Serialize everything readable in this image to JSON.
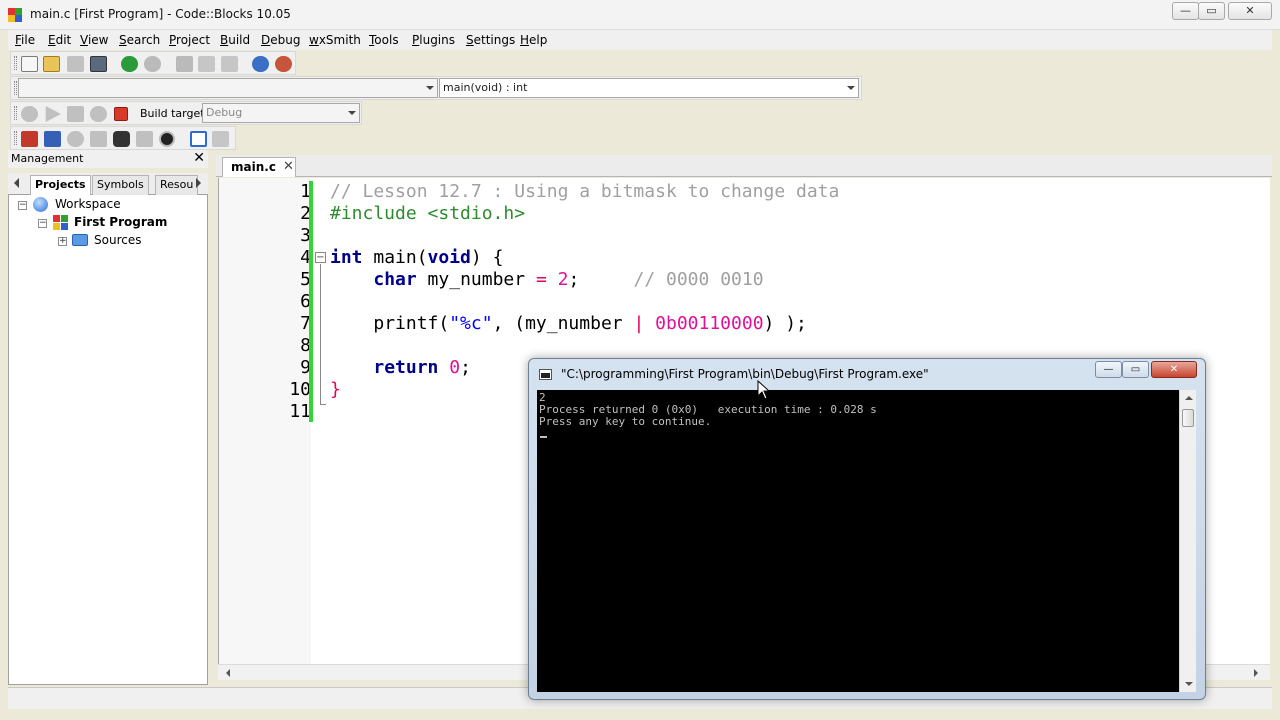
{
  "window": {
    "title": "main.c [First Program] - Code::Blocks 10.05",
    "min_glyph": "—",
    "max_glyph": "▭",
    "close_glyph": "✕"
  },
  "menu": {
    "items": [
      "File",
      "Edit",
      "View",
      "Search",
      "Project",
      "Build",
      "Debug",
      "wxSmith",
      "Tools",
      "Plugins",
      "Settings",
      "Help"
    ]
  },
  "toolbar": {
    "function_combo": "main(void) : int",
    "build_target_label": "Build target:",
    "build_target_value": "Debug",
    "icons": [
      "new-file-icon",
      "open-icon",
      "save-icon",
      "save-all-icon",
      "undo-icon",
      "redo-icon",
      "cut-icon",
      "copy-icon",
      "paste-icon",
      "find-icon",
      "replace-icon"
    ]
  },
  "management": {
    "title": "Management",
    "close_glyph": "✕",
    "tabs": [
      "Projects",
      "Symbols",
      "Resou"
    ],
    "active_tab": "Projects",
    "tree": {
      "workspace": "Workspace",
      "project": "First Program",
      "folder": "Sources"
    }
  },
  "editor": {
    "tab_label": "main.c",
    "tab_close": "✕",
    "line_numbers": [
      "1",
      "2",
      "3",
      "4",
      "5",
      "6",
      "7",
      "8",
      "9",
      "10",
      "11"
    ],
    "code": {
      "l1": "// Lesson 12.7 : Using a bitmask to change data",
      "l2": "#include <stdio.h>",
      "l4_kw1": "int",
      "l4_mid": " main(",
      "l4_kw2": "void",
      "l4_end": ") {",
      "l5_kw": "char",
      "l5_mid": " my_number ",
      "l5_op": "=",
      "l5_sp": " ",
      "l5_num": "2",
      "l5_semi": ";",
      "l5_comment": "// 0000 0010",
      "l7_fn": "printf(",
      "l7_str": "\"%c\"",
      "l7_a": ", (my_number ",
      "l7_op": "|",
      "l7_sp": " ",
      "l7_num": "0b00110000",
      "l7_b": ") );",
      "l9_kw": "return",
      "l9_sp": " ",
      "l9_num": "0",
      "l9_semi": ";",
      "l10": "}"
    },
    "fold_glyph": "−"
  },
  "console": {
    "title": "\"C:\\programming\\First Program\\bin\\Debug\\First Program.exe\"",
    "lines": [
      "2",
      "Process returned 0 (0x0)   execution time : 0.028 s",
      "Press any key to continue."
    ],
    "min_glyph": "—",
    "max_glyph": "▭",
    "close_glyph": "✕"
  },
  "colors": {
    "change_bar": "#37d437",
    "keyword": "#00008b",
    "comment": "#a0a0a0",
    "preprocessor": "#2e8b2e",
    "number": "#e0109a",
    "string": "#0000ff"
  }
}
